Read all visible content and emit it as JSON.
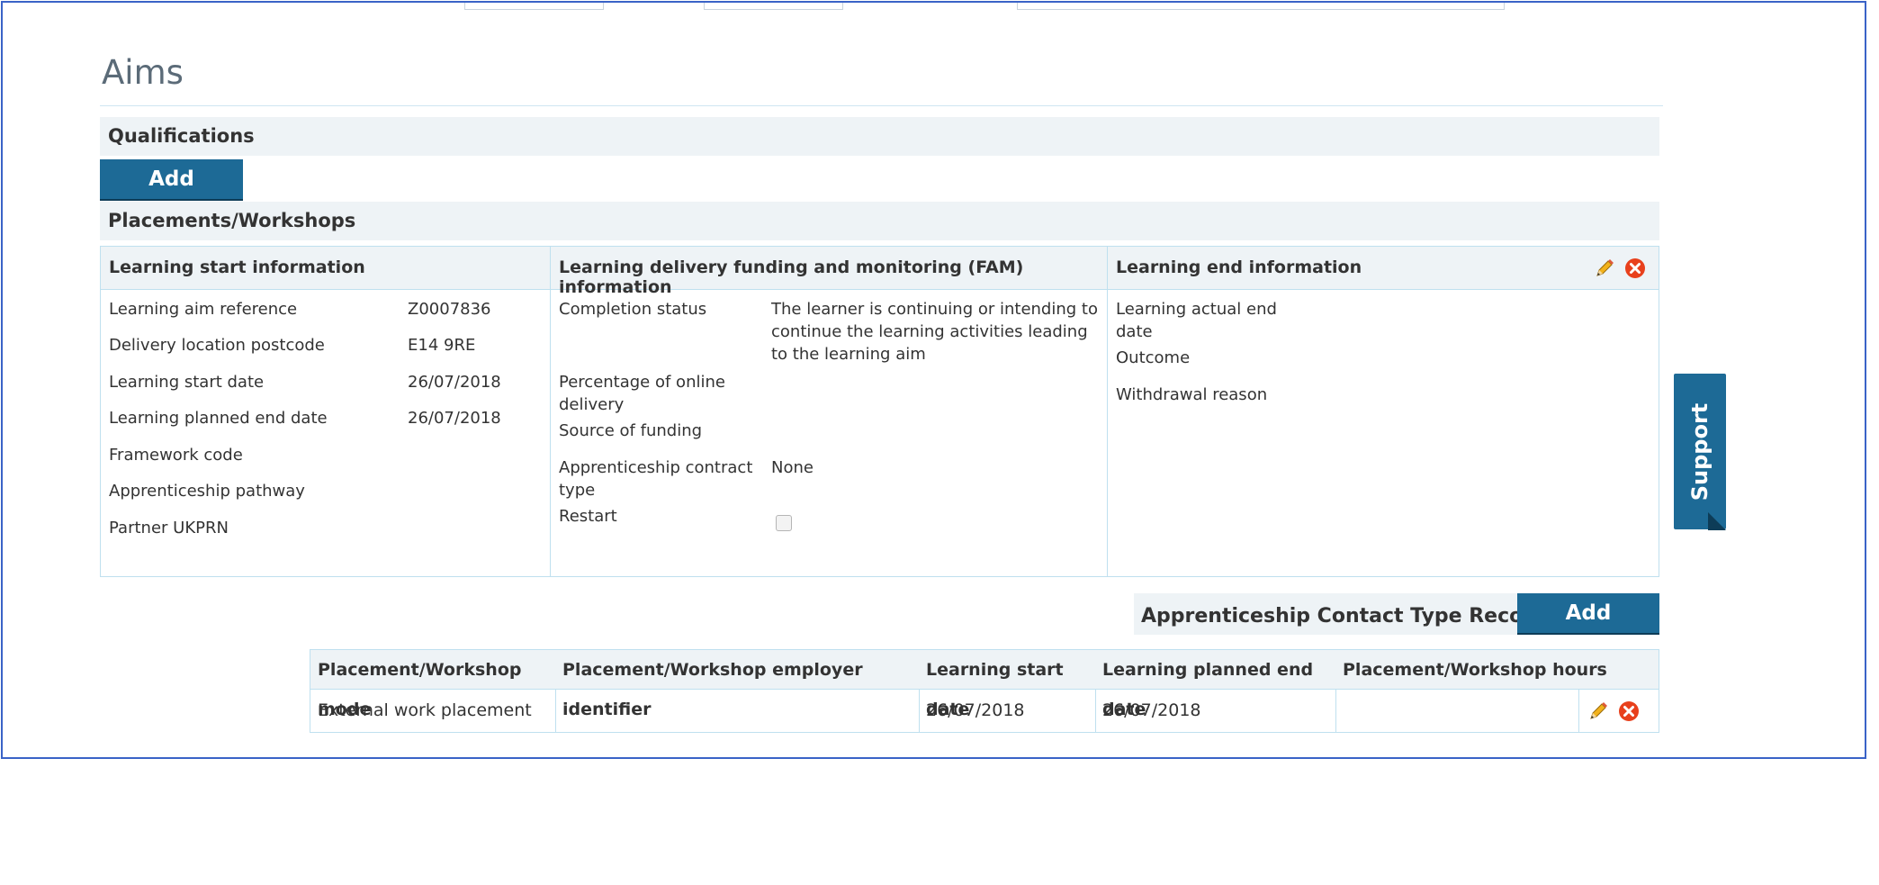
{
  "page": {
    "title": "Aims"
  },
  "qualifications": {
    "heading": "Qualifications",
    "add_label": "Add"
  },
  "placements": {
    "heading": "Placements/Workshops"
  },
  "learning_start": {
    "heading": "Learning start information",
    "rows": [
      {
        "label": "Learning aim reference",
        "value": "Z0007836"
      },
      {
        "label": "Delivery location postcode",
        "value": "E14 9RE"
      },
      {
        "label": "Learning start date",
        "value": "26/07/2018"
      },
      {
        "label": "Learning planned end date",
        "value": "26/07/2018"
      },
      {
        "label": "Framework code",
        "value": ""
      },
      {
        "label": "Apprenticeship pathway",
        "value": ""
      },
      {
        "label": "Partner UKPRN",
        "value": ""
      }
    ]
  },
  "fam": {
    "heading": "Learning delivery funding and monitoring (FAM) information",
    "completion_status_label": "Completion status",
    "completion_status_value_l1": "The learner is continuing or intending to",
    "completion_status_value_l2": "continue the learning activities leading",
    "completion_status_value_l3": "to the learning aim",
    "online_delivery_label_l1": "Percentage of online",
    "online_delivery_label_l2": "delivery",
    "source_funding_label": "Source of funding",
    "contract_type_label_l1": "Apprenticeship contract",
    "contract_type_label_l2": "type",
    "contract_type_value": "None",
    "restart_label": "Restart",
    "restart_checked": false
  },
  "learning_end": {
    "heading": "Learning end information",
    "actual_end_label_l1": "Learning actual end",
    "actual_end_label_l2": "date",
    "outcome_label": "Outcome",
    "withdrawal_label": "Withdrawal reason"
  },
  "support": {
    "label": "Support"
  },
  "apprenticeship_contact": {
    "heading": "Apprenticeship Contact Type Records",
    "add_label": "Add"
  },
  "table": {
    "headers": [
      "Placement/Workshop mode",
      "Placement/Workshop employer identifier",
      "Learning start date",
      "Learning planned end date",
      "Placement/Workshop hours"
    ],
    "rows": [
      {
        "mode": "External work placement",
        "employer": "",
        "start": "26/07/2018",
        "end": "26/07/2018",
        "hours": ""
      }
    ]
  },
  "icons": {
    "edit": "pencil-icon",
    "delete": "delete-icon"
  },
  "colors": {
    "accent": "#1d6a96",
    "border": "#bfe0ef",
    "header_bg": "#eef3f6",
    "delete": "#e8401c",
    "frame": "#3a63c7"
  }
}
